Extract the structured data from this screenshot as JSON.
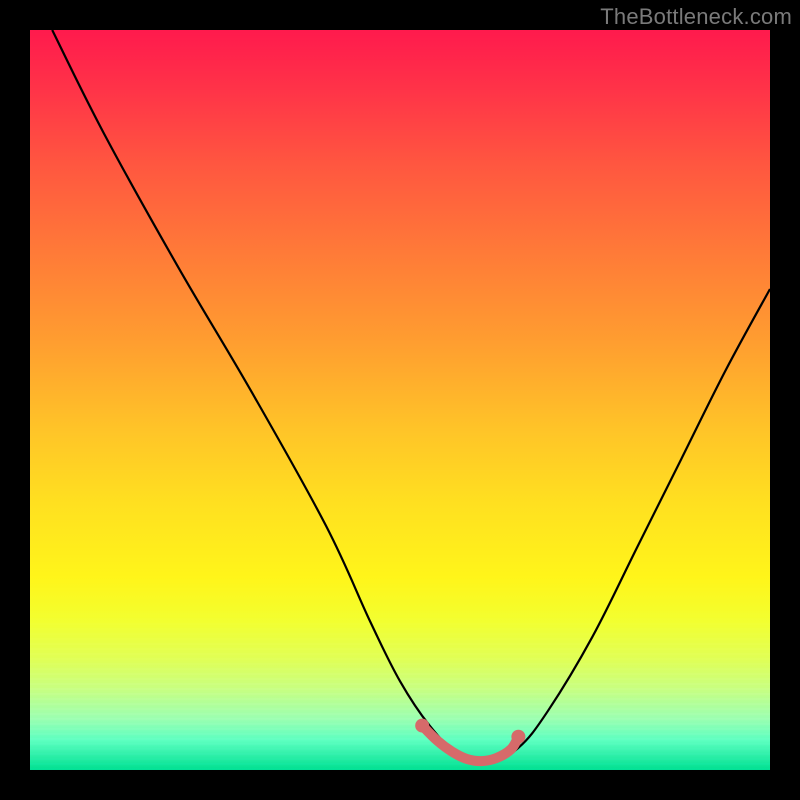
{
  "watermark": {
    "text": "TheBottleneck.com"
  },
  "colors": {
    "frame": "#000000",
    "curve_stroke": "#000000",
    "plateau_stroke": "#d66a6a",
    "plateau_fill": "#d66a6a"
  },
  "chart_data": {
    "type": "line",
    "title": "",
    "xlabel": "",
    "ylabel": "",
    "xlim": [
      0,
      100
    ],
    "ylim": [
      0,
      100
    ],
    "grid": false,
    "legend": false,
    "series": [
      {
        "name": "bottleneck-curve",
        "x": [
          3,
          10,
          20,
          30,
          40,
          46,
          50,
          54,
          58,
          62,
          66,
          70,
          76,
          82,
          88,
          94,
          100
        ],
        "y": [
          100,
          86,
          68,
          51,
          33,
          20,
          12,
          6,
          2,
          1,
          3,
          8,
          18,
          30,
          42,
          54,
          65
        ]
      },
      {
        "name": "plateau-segment",
        "x": [
          53,
          55,
          57,
          59,
          61,
          63,
          65,
          66
        ],
        "y": [
          6,
          4,
          2.5,
          1.5,
          1.2,
          1.6,
          2.8,
          4.5
        ]
      }
    ]
  }
}
